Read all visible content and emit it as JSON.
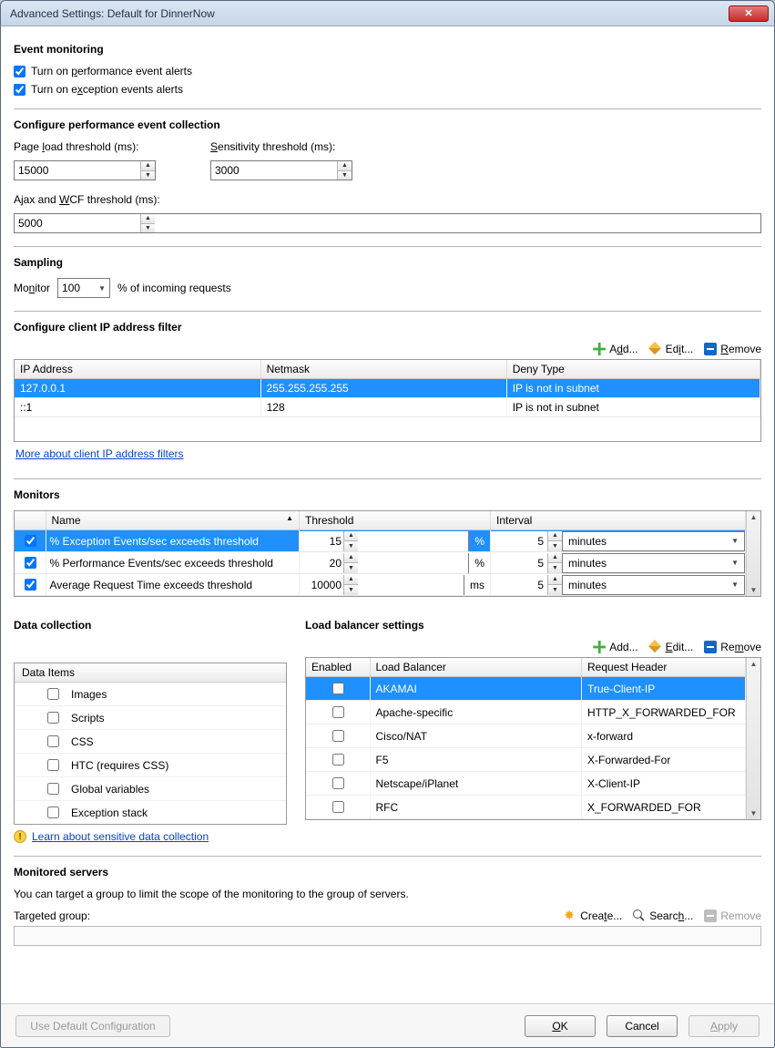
{
  "window": {
    "title": "Advanced Settings: Default for DinnerNow"
  },
  "event_monitoring": {
    "heading": "Event monitoring",
    "perf_alerts_label": "Turn on performance event alerts",
    "exc_alerts_label": "Turn on exception events alerts"
  },
  "perf_collection": {
    "heading": "Configure performance event collection",
    "page_load_label": "Page load threshold (ms):",
    "page_load_value": "15000",
    "sensitivity_label": "Sensitivity threshold (ms):",
    "sensitivity_value": "3000",
    "ajax_label": "Ajax and WCF threshold (ms):",
    "ajax_value": "5000"
  },
  "sampling": {
    "heading": "Sampling",
    "monitor_label": "Monitor",
    "percent_value": "100",
    "suffix": "% of incoming requests"
  },
  "ip_filter": {
    "heading": "Configure client IP address filter",
    "add": "Add...",
    "edit": "Edit...",
    "remove": "Remove",
    "col_ip": "IP Address",
    "col_mask": "Netmask",
    "col_deny": "Deny Type",
    "rows": [
      {
        "ip": "127.0.0.1",
        "mask": "255.255.255.255",
        "deny": "IP is not in subnet",
        "selected": true
      },
      {
        "ip": "::1",
        "mask": "128",
        "deny": "IP is not in subnet",
        "selected": false
      }
    ],
    "link": "More about client IP address filters"
  },
  "monitors": {
    "heading": "Monitors",
    "col_name": "Name",
    "col_threshold": "Threshold",
    "col_interval": "Interval",
    "rows": [
      {
        "checked": true,
        "name": "% Exception Events/sec exceeds threshold",
        "threshold": "15",
        "unit": "%",
        "interval": "5",
        "interval_unit": "minutes",
        "selected": true
      },
      {
        "checked": true,
        "name": "% Performance Events/sec exceeds threshold",
        "threshold": "20",
        "unit": "%",
        "interval": "5",
        "interval_unit": "minutes",
        "selected": false
      },
      {
        "checked": true,
        "name": "Average Request Time exceeds threshold",
        "threshold": "10000",
        "unit": "ms",
        "interval": "5",
        "interval_unit": "minutes",
        "selected": false
      }
    ]
  },
  "data_collection": {
    "heading": "Data collection",
    "col": "Data Items",
    "items": [
      {
        "label": "Images",
        "checked": false
      },
      {
        "label": "Scripts",
        "checked": false
      },
      {
        "label": "CSS",
        "checked": false
      },
      {
        "label": "HTC (requires CSS)",
        "checked": false
      },
      {
        "label": "Global variables",
        "checked": false
      },
      {
        "label": "Exception stack",
        "checked": false
      }
    ],
    "link": "Learn about sensitive data collection"
  },
  "load_balancer": {
    "heading": "Load balancer settings",
    "add": "Add...",
    "edit": "Edit...",
    "remove": "Remove",
    "col_enabled": "Enabled",
    "col_lb": "Load Balancer",
    "col_hdr": "Request Header",
    "rows": [
      {
        "enabled": false,
        "lb": "AKAMAI",
        "hdr": "True-Client-IP",
        "selected": true
      },
      {
        "enabled": false,
        "lb": "Apache-specific",
        "hdr": "HTTP_X_FORWARDED_FOR",
        "selected": false
      },
      {
        "enabled": false,
        "lb": "Cisco/NAT",
        "hdr": "x-forward",
        "selected": false
      },
      {
        "enabled": false,
        "lb": "F5",
        "hdr": "X-Forwarded-For",
        "selected": false
      },
      {
        "enabled": false,
        "lb": "Netscape/iPlanet",
        "hdr": "X-Client-IP",
        "selected": false
      },
      {
        "enabled": false,
        "lb": "RFC",
        "hdr": "X_FORWARDED_FOR",
        "selected": false
      }
    ]
  },
  "monitored_servers": {
    "heading": "Monitored servers",
    "desc": "You can target a group to limit the scope of the monitoring to the group of servers.",
    "targeted_label": "Targeted group:",
    "create": "Create...",
    "search": "Search...",
    "remove": "Remove"
  },
  "footer": {
    "use_default": "Use Default Configuration",
    "ok": "OK",
    "cancel": "Cancel",
    "apply": "Apply"
  }
}
